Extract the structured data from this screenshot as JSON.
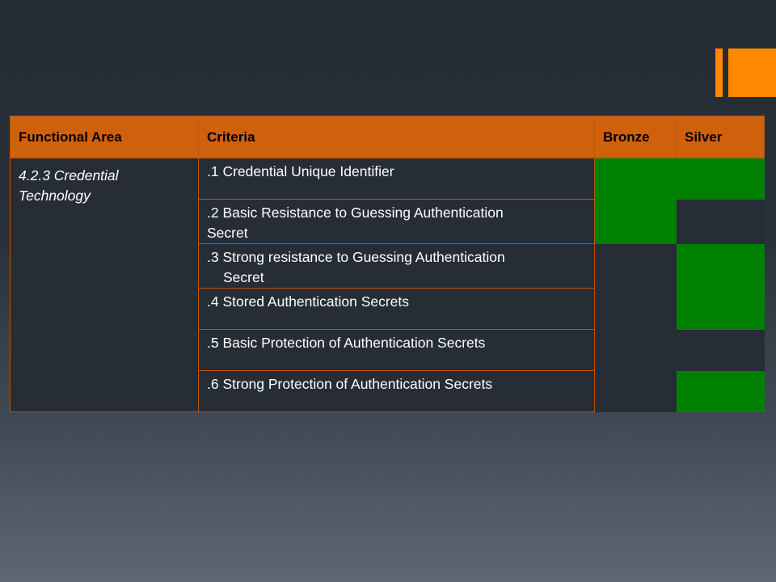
{
  "table": {
    "headers": {
      "functional_area": "Functional Area",
      "criteria": "Criteria",
      "bronze": "Bronze",
      "silver": "Silver"
    },
    "functional_area": "4.2.3 Credential Technology",
    "rows": [
      {
        "line1": ".1  Credential Unique Identifier",
        "line2": "",
        "bronze": true,
        "silver": true
      },
      {
        "line1": ".2  Basic Resistance to Guessing Authentication",
        "line2": "Secret",
        "bronze": true,
        "silver": false
      },
      {
        "line1": ".3  Strong resistance to Guessing Authentication",
        "line2": "Secret",
        "bronze": false,
        "silver": true
      },
      {
        "line1": ".4  Stored Authentication Secrets",
        "line2": "",
        "bronze": false,
        "silver": true
      },
      {
        "line1": ".5  Basic Protection of Authentication Secrets",
        "line2": "",
        "bronze": false,
        "silver": false
      },
      {
        "line1": ".6  Strong Protection of Authentication Secrets",
        "line2": "",
        "bronze": false,
        "silver": true
      }
    ]
  },
  "colors": {
    "header_bg": "#d0610c",
    "met_green": "#008000",
    "accent_orange": "#ff8800",
    "background": "#262d35"
  }
}
